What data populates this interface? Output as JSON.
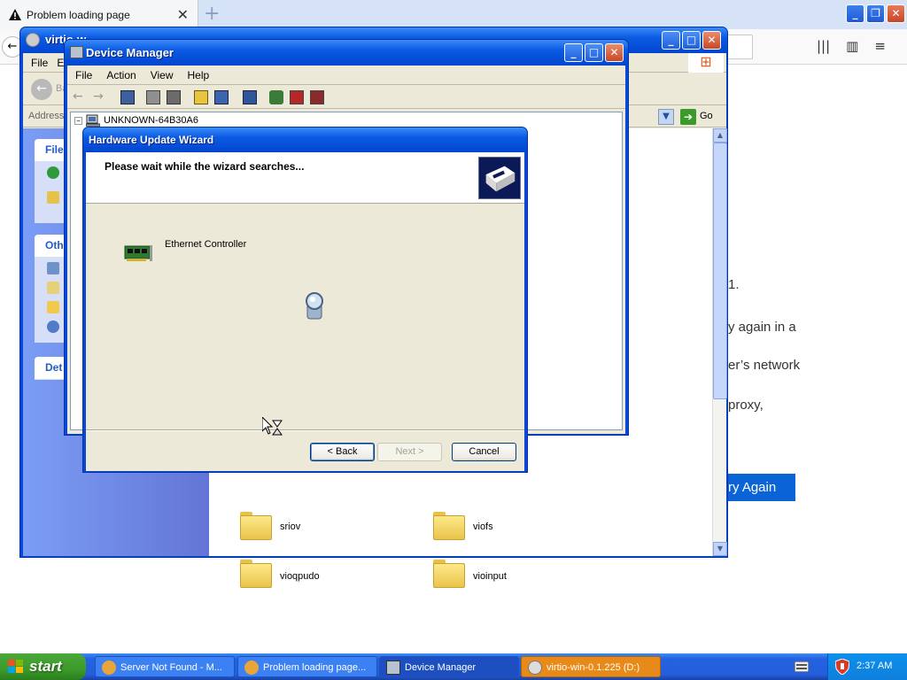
{
  "firefox": {
    "tab_title": "Problem loading page",
    "new_tab_glyph": "+",
    "close_glyph": "✕",
    "error_lines": [
      "1.",
      "y again in a",
      "er’s network",
      "proxy,"
    ],
    "try_again_label": "ry Again"
  },
  "explorer": {
    "title": "virtio-win-0.1.225 (D:)",
    "title_visible": "virtio-w",
    "menu": [
      "File",
      "E"
    ],
    "back_label": "Ba",
    "address_label": "Address",
    "go_label": "Go",
    "task_boxes": [
      {
        "header": "File"
      },
      {
        "header": "Oth"
      },
      {
        "header": "Det"
      }
    ],
    "folders": [
      {
        "name": "sriov"
      },
      {
        "name": "viofs"
      },
      {
        "name": "vioqpudo"
      },
      {
        "name": "vioinput"
      }
    ]
  },
  "device_manager": {
    "title": "Device Manager",
    "menu": [
      "File",
      "Action",
      "View",
      "Help"
    ],
    "tree_root": "UNKNOWN-64B30A6"
  },
  "wizard": {
    "title": "Hardware Update Wizard",
    "heading": "Please wait while the wizard searches...",
    "device_name": "Ethernet Controller",
    "back_label": "< Back",
    "next_label": "Next >",
    "cancel_label": "Cancel"
  },
  "taskbar": {
    "start_label": "start",
    "items": [
      {
        "label": "Server Not Found - M..."
      },
      {
        "label": "Problem loading page..."
      },
      {
        "label": "Device Manager"
      },
      {
        "label": "virtio-win-0.1.225 (D:)"
      }
    ],
    "clock": "2:37 AM"
  },
  "colors": {
    "xp_title_blue": "#0a5ae3",
    "firefox_button_blue": "#0a64d6",
    "start_green": "#3c9a2b"
  }
}
